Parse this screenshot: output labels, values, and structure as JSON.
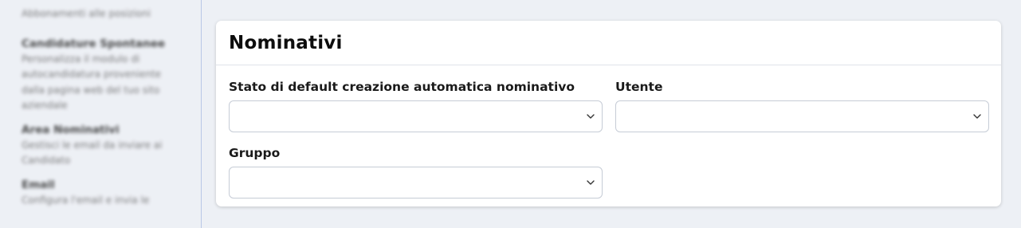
{
  "sidebar": {
    "top_text": "Abbonamenti alle posizioni",
    "items": [
      {
        "title": "Candidature Spontanee",
        "desc": "Personalizza il modulo di autocandidatura proveniente dalla pagina web del tuo sito aziendale"
      },
      {
        "title": "Area Nominativi",
        "desc": "Gestisci le email da inviare ai Candidato"
      },
      {
        "title": "Email",
        "desc": "Configura l'email e invia le"
      }
    ]
  },
  "card": {
    "title": "Nominativi",
    "fields": {
      "stato": {
        "label": "Stato di default creazione automatica nominativo",
        "value": ""
      },
      "utente": {
        "label": "Utente",
        "value": ""
      },
      "gruppo": {
        "label": "Gruppo",
        "value": ""
      }
    }
  },
  "colors": {
    "background": "#edf0f5",
    "card": "#ffffff",
    "border": "#c6ccd6",
    "sidebar_divider": "#b9c7e6"
  }
}
